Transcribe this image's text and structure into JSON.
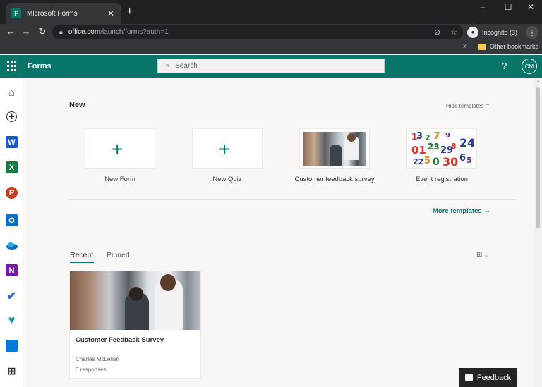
{
  "browser": {
    "tab_title": "Microsoft Forms",
    "tab_favicon_letter": "F",
    "url_host": "office.com",
    "url_path": "/launch/forms?auth=1",
    "incognito_label": "Incognito (3)",
    "other_bookmarks": "Other bookmarks"
  },
  "app": {
    "title": "Forms",
    "search_placeholder": "Search",
    "help_icon": "?",
    "avatar_initials": "CM",
    "brand_color": "#077568"
  },
  "rail": {
    "icons": [
      "home-icon",
      "create-icon",
      "word-icon",
      "excel-icon",
      "powerpoint-icon",
      "outlook-icon",
      "onedrive-icon",
      "onenote-icon",
      "todo-icon",
      "family-safety-icon",
      "all-apps-icon",
      "add-app-icon"
    ]
  },
  "new_section": {
    "heading": "New",
    "hide_templates": "Hide templates",
    "tiles": [
      {
        "label": "New Form"
      },
      {
        "label": "New Quiz"
      },
      {
        "label": "Customer feedback survey"
      },
      {
        "label": "Event registration"
      }
    ],
    "more_templates": "More templates"
  },
  "recent": {
    "tabs": {
      "recent": "Recent",
      "pinned": "Pinned"
    },
    "cards": [
      {
        "title": "Customer Feedback Survey",
        "owner": "Charles McLellan",
        "responses": "0 responses"
      }
    ]
  },
  "feedback_button": "Feedback"
}
